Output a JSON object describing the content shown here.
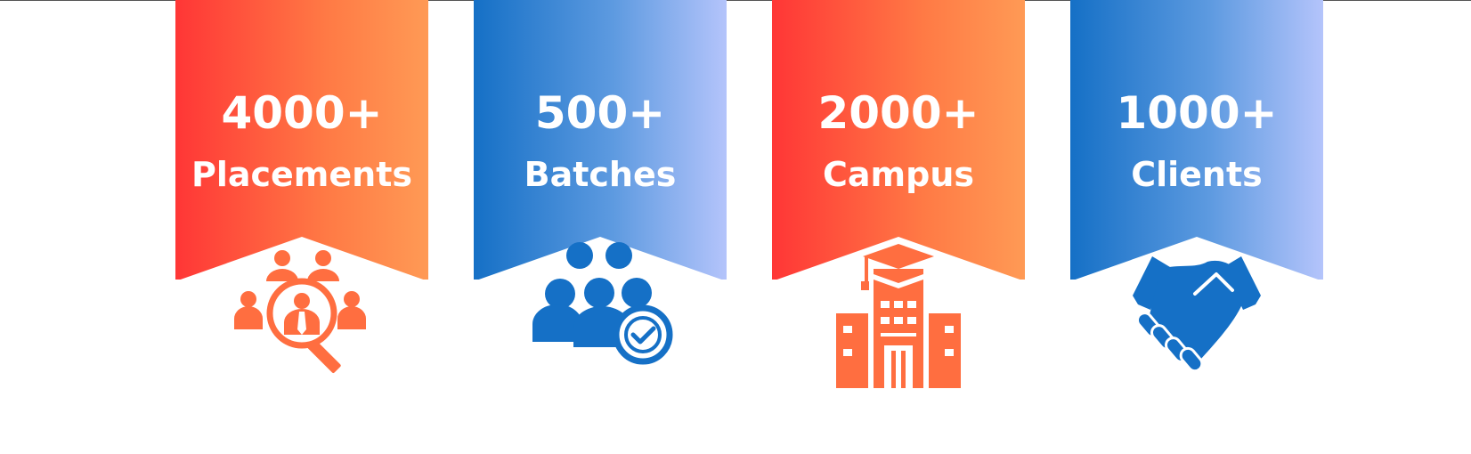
{
  "stats": [
    {
      "value": "4000+",
      "label": "Placements",
      "icon": "recruitment-search-icon",
      "theme": "warm"
    },
    {
      "value": "500+",
      "label": "Batches",
      "icon": "group-check-icon",
      "theme": "cool"
    },
    {
      "value": "2000+",
      "label": "Campus",
      "icon": "campus-building-icon",
      "theme": "warm"
    },
    {
      "value": "1000+",
      "label": "Clients",
      "icon": "handshake-icon",
      "theme": "cool"
    }
  ],
  "colors": {
    "warm_start": "#ff3636",
    "warm_end": "#ff9a55",
    "cool_start": "#1570c6",
    "cool_end": "#b4c4fb",
    "icon_orange": "#ff6e40",
    "icon_blue": "#1570c6"
  }
}
